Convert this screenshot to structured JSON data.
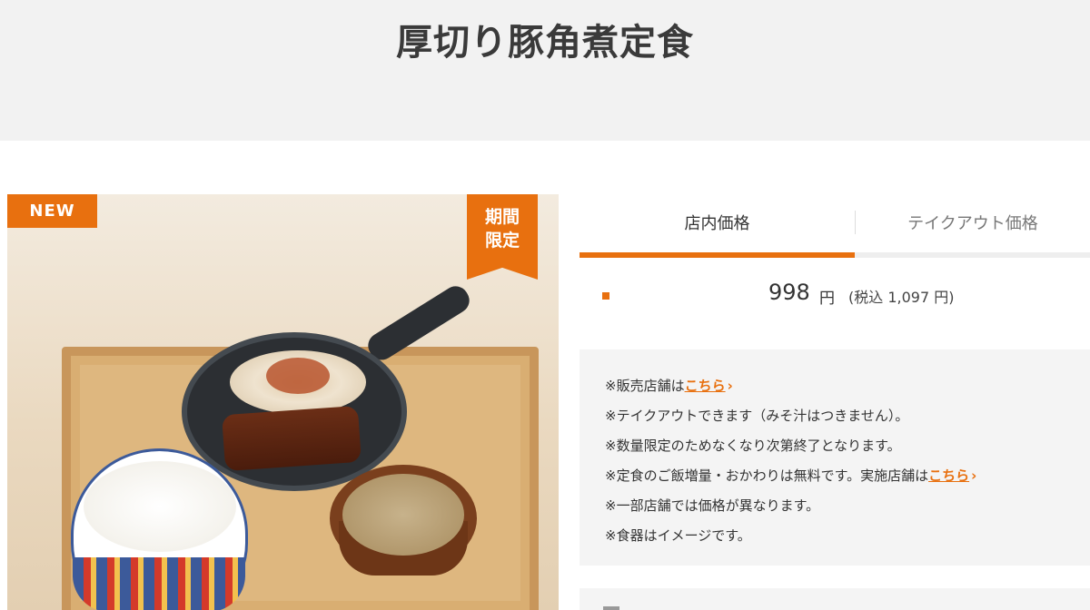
{
  "header": {
    "title": "厚切り豚角煮定食"
  },
  "photo": {
    "badge_new": "NEW",
    "badge_limited_line1": "期間",
    "badge_limited_line2": "限定"
  },
  "tabs": [
    {
      "label": "店内価格",
      "active": true
    },
    {
      "label": "テイクアウト価格",
      "active": false
    }
  ],
  "price": {
    "value": "998",
    "unit": "円",
    "tax_included": "(税込 1,097 円)"
  },
  "notes": [
    {
      "prefix": "※販売店舗は",
      "link": "こちら",
      "suffix": ""
    },
    {
      "prefix": "※テイクアウトできます（みそ汁はつきません）。",
      "link": "",
      "suffix": ""
    },
    {
      "prefix": "※数量限定のためなくなり次第終了となります。",
      "link": "",
      "suffix": ""
    },
    {
      "prefix": "※定食のご飯増量・おかわりは無料です。実施店舗は",
      "link": "こちら",
      "suffix": ""
    },
    {
      "prefix": "※一部店舗では価格が異なります。",
      "link": "",
      "suffix": ""
    },
    {
      "prefix": "※食器はイメージです。",
      "link": "",
      "suffix": ""
    }
  ],
  "colors": {
    "accent": "#e8700f",
    "band": "#f2f2f2",
    "notes_bg": "#f4f4f4"
  }
}
